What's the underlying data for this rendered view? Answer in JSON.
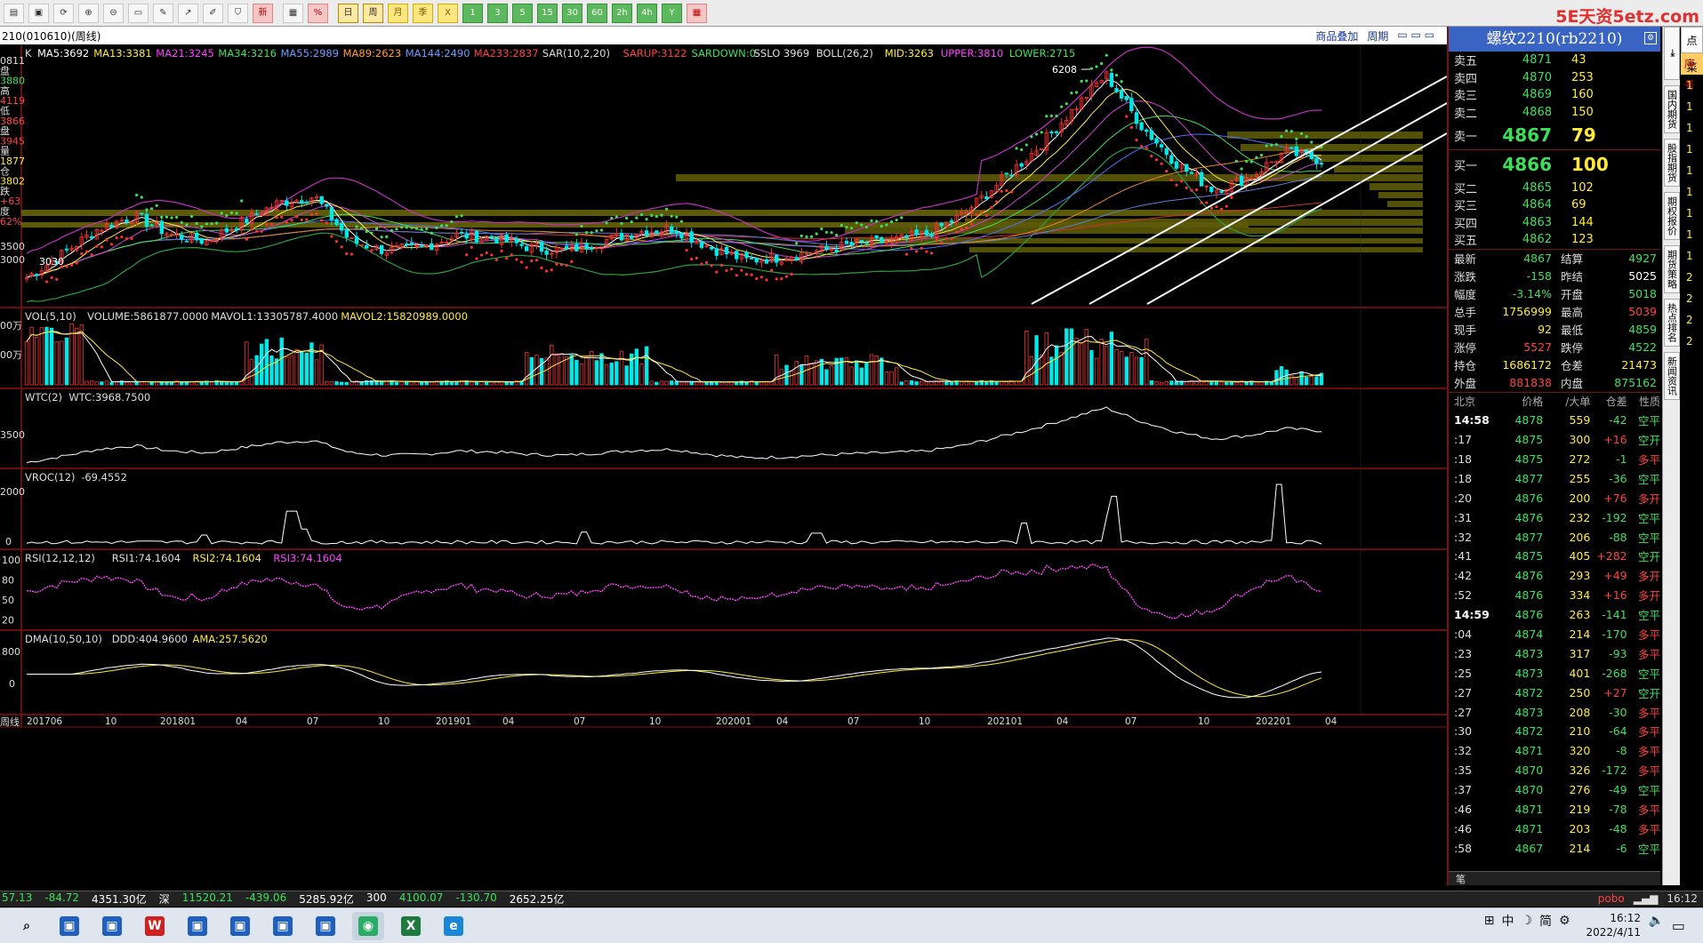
{
  "app": {
    "brand": "5E天资5etz.com",
    "symbol_line": "210(010610)(周线)",
    "tabs_right": [
      "商品叠加",
      "周期"
    ]
  },
  "toolbar": {
    "buttons": [
      {
        "name": "file",
        "label": "▤"
      },
      {
        "name": "open",
        "label": "▣"
      },
      {
        "name": "refresh",
        "label": "⟳"
      },
      {
        "name": "zoom-in",
        "label": "⊕"
      },
      {
        "name": "zoom-out",
        "label": "⊖"
      },
      {
        "name": "window",
        "label": "▭"
      },
      {
        "name": "draw",
        "label": "✎"
      },
      {
        "name": "line",
        "label": "↗"
      },
      {
        "name": "pen",
        "label": "✐"
      },
      {
        "name": "funnel",
        "label": "⛉"
      },
      {
        "name": "new",
        "label": "新"
      },
      {
        "name": "table",
        "label": "▦"
      },
      {
        "name": "percent",
        "label": "%"
      },
      {
        "name": "day",
        "label": "日"
      },
      {
        "name": "week",
        "label": "周"
      },
      {
        "name": "month",
        "label": "月"
      },
      {
        "name": "season",
        "label": "季"
      },
      {
        "name": "x",
        "label": "X"
      },
      {
        "name": "m1",
        "label": "1"
      },
      {
        "name": "m3",
        "label": "3"
      },
      {
        "name": "m5",
        "label": "5"
      },
      {
        "name": "m15",
        "label": "15"
      },
      {
        "name": "m30",
        "label": "30"
      },
      {
        "name": "m60",
        "label": "60"
      },
      {
        "name": "h2",
        "label": "2h"
      },
      {
        "name": "h4",
        "label": "4h"
      },
      {
        "name": "y",
        "label": "Y"
      },
      {
        "name": "calendar",
        "label": "▦"
      }
    ]
  },
  "main_legend": {
    "k": "K",
    "items": [
      {
        "t": "MA5:3692",
        "c": "#ffffff"
      },
      {
        "t": "MA13:3381",
        "c": "#ffea3a"
      },
      {
        "t": "MA21:3245",
        "c": "#ff40ff"
      },
      {
        "t": "MA34:3216",
        "c": "#3de05b"
      },
      {
        "t": "MA55:2989",
        "c": "#6a9cff"
      },
      {
        "t": "MA89:2623",
        "c": "#ff9a30"
      },
      {
        "t": "MA144:2490",
        "c": "#6a9cff"
      },
      {
        "t": "MA233:2837",
        "c": "#ff4040"
      },
      {
        "t": "SAR(10,2,20)",
        "c": "#dddddd"
      },
      {
        "t": "SARUP:3122",
        "c": "#ff4040"
      },
      {
        "t": "SARDOWN:0",
        "c": "#3de05b"
      },
      {
        "t": "SSLO 3969",
        "c": "#dddddd"
      },
      {
        "t": "BOLL(26,2)",
        "c": "#dddddd"
      },
      {
        "t": "MID:3263",
        "c": "#ffea3a"
      },
      {
        "t": "UPPER:3810",
        "c": "#ff40ff"
      },
      {
        "t": "LOWER:2715",
        "c": "#3de05b"
      }
    ]
  },
  "left_axis": {
    "main": [
      "0811",
      "盘",
      "3880",
      "高",
      "4119",
      "低",
      "3866",
      "盘",
      "3945",
      "量",
      "1877",
      "仓",
      "3802",
      "跌",
      "+63",
      "度",
      "62%"
    ],
    "main_ticks": [
      "3500",
      "3000"
    ],
    "vol_ticks": [
      "00万",
      "00万"
    ],
    "wtc_ticks": [
      "3500"
    ],
    "vroc_ticks": [
      "2000",
      "0"
    ],
    "rsi_ticks": [
      "100",
      "80",
      "50",
      "20"
    ],
    "dma_ticks": [
      "800",
      "0"
    ]
  },
  "annotations": {
    "high": "6208",
    "low": "3030"
  },
  "sub_legends": {
    "vol": [
      {
        "t": "VOL(5,10)",
        "c": "#dddddd"
      },
      {
        "t": "VOLUME:5861877.0000",
        "c": "#dddddd"
      },
      {
        "t": "MAVOL1:13305787.4000",
        "c": "#dddddd"
      },
      {
        "t": "MAVOL2:15820989.0000",
        "c": "#ffea3a"
      }
    ],
    "wtc": [
      {
        "t": "WTC(2)",
        "c": "#dddddd"
      },
      {
        "t": "WTC:3968.7500",
        "c": "#dddddd"
      }
    ],
    "vroc": [
      {
        "t": "VROC(12)",
        "c": "#dddddd"
      },
      {
        "t": "-69.4552",
        "c": "#dddddd"
      }
    ],
    "rsi": [
      {
        "t": "RSI(12,12,12)",
        "c": "#dddddd"
      },
      {
        "t": "RSI1:74.1604",
        "c": "#dddddd"
      },
      {
        "t": "RSI2:74.1604",
        "c": "#ffea3a"
      },
      {
        "t": "RSI3:74.1604",
        "c": "#ff40ff"
      }
    ],
    "dma": [
      {
        "t": "DMA(10,50,10)",
        "c": "#dddddd"
      },
      {
        "t": "DDD:404.9600",
        "c": "#dddddd"
      },
      {
        "t": "AMA:257.5620",
        "c": "#ffea3a"
      }
    ]
  },
  "x_axis": {
    "period_label": "周线",
    "labels": [
      "201706",
      "10",
      "201801",
      "04",
      "07",
      "10",
      "201901",
      "04",
      "07",
      "10",
      "202001",
      "04",
      "07",
      "10",
      "202101",
      "04",
      "07",
      "10",
      "202201",
      "04"
    ]
  },
  "quote": {
    "title": "螺纹2210(rb2210)",
    "asks": [
      {
        "k": "卖五",
        "p": "4871",
        "v": "43"
      },
      {
        "k": "卖四",
        "p": "4870",
        "v": "253"
      },
      {
        "k": "卖三",
        "p": "4869",
        "v": "160"
      },
      {
        "k": "卖二",
        "p": "4868",
        "v": "150"
      },
      {
        "k": "卖一",
        "p": "4867",
        "v": "79"
      }
    ],
    "bids": [
      {
        "k": "买一",
        "p": "4866",
        "v": "100"
      },
      {
        "k": "买二",
        "p": "4865",
        "v": "102"
      },
      {
        "k": "买三",
        "p": "4864",
        "v": "69"
      },
      {
        "k": "买四",
        "p": "4863",
        "v": "144"
      },
      {
        "k": "买五",
        "p": "4862",
        "v": "123"
      }
    ],
    "stats": [
      {
        "k1": "最新",
        "v1": "4867",
        "c1": "g",
        "k2": "结算",
        "v2": "4927",
        "c2": "g"
      },
      {
        "k1": "涨跌",
        "v1": "-158",
        "c1": "g",
        "k2": "昨结",
        "v2": "5025",
        "c2": "w"
      },
      {
        "k1": "幅度",
        "v1": "-3.14%",
        "c1": "g",
        "k2": "开盘",
        "v2": "5018",
        "c2": "g"
      },
      {
        "k1": "总手",
        "v1": "1756999",
        "c1": "y",
        "k2": "最高",
        "v2": "5039",
        "c2": "r"
      },
      {
        "k1": "现手",
        "v1": "92",
        "c1": "y",
        "k2": "最低",
        "v2": "4859",
        "c2": "g"
      },
      {
        "k1": "涨停",
        "v1": "5527",
        "c1": "r",
        "k2": "跌停",
        "v2": "4522",
        "c2": "g"
      },
      {
        "k1": "持仓",
        "v1": "1686172",
        "c1": "y",
        "k2": "仓差",
        "v2": "21473",
        "c2": "y"
      },
      {
        "k1": "外盘",
        "v1": "881838",
        "c1": "r",
        "k2": "内盘",
        "v2": "875162",
        "c2": "g"
      }
    ],
    "tick_header": [
      "北京",
      "价格",
      "∕大单",
      "仓差",
      "性质"
    ],
    "ticks": [
      {
        "t": "14:58",
        "b": true,
        "p": "4878",
        "v": "559",
        "d": "-42",
        "dc": "g",
        "n": "空平",
        "nc": "g",
        "vc": "r"
      },
      {
        "t": ":17",
        "p": "4875",
        "v": "300",
        "d": "+16",
        "dc": "r",
        "n": "空开",
        "nc": "g",
        "vc": "y"
      },
      {
        "t": ":18",
        "p": "4875",
        "v": "272",
        "d": "-1",
        "dc": "g",
        "n": "多平",
        "nc": "r",
        "vc": "y"
      },
      {
        "t": ":18",
        "p": "4877",
        "v": "255",
        "d": "-36",
        "dc": "g",
        "n": "空平",
        "nc": "g",
        "vc": "r"
      },
      {
        "t": ":20",
        "p": "4876",
        "v": "200",
        "d": "+76",
        "dc": "r",
        "n": "多开",
        "nc": "r",
        "vc": "r"
      },
      {
        "t": ":31",
        "p": "4876",
        "v": "232",
        "d": "-192",
        "dc": "g",
        "n": "空平",
        "nc": "g",
        "vc": "r"
      },
      {
        "t": ":32",
        "p": "4877",
        "v": "206",
        "d": "-88",
        "dc": "g",
        "n": "空平",
        "nc": "g",
        "vc": "r"
      },
      {
        "t": ":41",
        "p": "4875",
        "v": "405",
        "d": "+282",
        "dc": "r",
        "n": "空开",
        "nc": "g",
        "vc": "y"
      },
      {
        "t": ":42",
        "p": "4876",
        "v": "293",
        "d": "+49",
        "dc": "r",
        "n": "多开",
        "nc": "r",
        "vc": "r"
      },
      {
        "t": ":52",
        "p": "4876",
        "v": "334",
        "d": "+16",
        "dc": "r",
        "n": "多开",
        "nc": "r",
        "vc": "r"
      },
      {
        "t": "14:59",
        "b": true,
        "p": "4876",
        "v": "263",
        "d": "-141",
        "dc": "g",
        "n": "空平",
        "nc": "g",
        "vc": "r"
      },
      {
        "t": ":04",
        "p": "4874",
        "v": "214",
        "d": "-170",
        "dc": "g",
        "n": "多平",
        "nc": "r",
        "vc": "y"
      },
      {
        "t": ":23",
        "p": "4873",
        "v": "317",
        "d": "-93",
        "dc": "g",
        "n": "多平",
        "nc": "r",
        "vc": "y"
      },
      {
        "t": ":25",
        "p": "4873",
        "v": "401",
        "d": "-268",
        "dc": "g",
        "n": "空平",
        "nc": "g",
        "vc": "r"
      },
      {
        "t": ":27",
        "p": "4872",
        "v": "250",
        "d": "+27",
        "dc": "r",
        "n": "空开",
        "nc": "g",
        "vc": "y"
      },
      {
        "t": ":27",
        "p": "4873",
        "v": "208",
        "d": "-30",
        "dc": "g",
        "n": "多平",
        "nc": "r",
        "vc": "y"
      },
      {
        "t": ":30",
        "p": "4872",
        "v": "210",
        "d": "-64",
        "dc": "g",
        "n": "多平",
        "nc": "r",
        "vc": "y"
      },
      {
        "t": ":32",
        "p": "4871",
        "v": "320",
        "d": "-8",
        "dc": "g",
        "n": "多平",
        "nc": "r",
        "vc": "y"
      },
      {
        "t": ":35",
        "p": "4870",
        "v": "326",
        "d": "-172",
        "dc": "g",
        "n": "多平",
        "nc": "r",
        "vc": "y"
      },
      {
        "t": ":37",
        "p": "4870",
        "v": "276",
        "d": "-49",
        "dc": "g",
        "n": "空平",
        "nc": "g",
        "vc": "r"
      },
      {
        "t": ":46",
        "p": "4871",
        "v": "219",
        "d": "-78",
        "dc": "g",
        "n": "多平",
        "nc": "r",
        "vc": "y"
      },
      {
        "t": ":46",
        "p": "4871",
        "v": "203",
        "d": "-48",
        "dc": "g",
        "n": "多平",
        "nc": "r",
        "vc": "y"
      },
      {
        "t": ":58",
        "p": "4867",
        "v": "214",
        "d": "-6",
        "dc": "g",
        "n": "空平",
        "nc": "g",
        "vc": "r"
      }
    ],
    "bottom_tab": "笔"
  },
  "side_tabs": [
    "国内期货",
    "股指期货",
    "期权报价",
    "期货策略",
    "热点排名",
    "新闻资讯"
  ],
  "far_right": {
    "hdr": "点菜",
    "hdr2": "序号",
    "cells": [
      "1",
      "1",
      "1",
      "1",
      "1",
      "1",
      "1",
      "1",
      "1",
      "2",
      "2",
      "2",
      "2"
    ]
  },
  "status": {
    "segs": [
      {
        "t": "57.13",
        "c": "g"
      },
      {
        "t": "-84.72",
        "c": "g"
      },
      {
        "t": "4351.30亿",
        "c": "w"
      },
      {
        "t": "深",
        "c": "w"
      },
      {
        "t": "11520.21",
        "c": "g"
      },
      {
        "t": "-439.06",
        "c": "g"
      },
      {
        "t": "5285.92亿",
        "c": "w"
      },
      {
        "t": "300",
        "c": "w"
      },
      {
        "t": "4100.07",
        "c": "g"
      },
      {
        "t": "-130.70",
        "c": "g"
      },
      {
        "t": "2652.25亿",
        "c": "w"
      }
    ],
    "right": [
      "pobo",
      "16:12"
    ]
  },
  "taskbar": {
    "apps": [
      "search",
      "app1",
      "app2",
      "wps",
      "app3",
      "app4",
      "app5",
      "app6",
      "wechat",
      "excel",
      "edge"
    ],
    "tray": [
      "中",
      "简"
    ],
    "time": "16:12",
    "date": "2022/4/11"
  },
  "chart_data": {
    "type": "candlestick",
    "title": "",
    "period": "weekly",
    "x_labels": [
      "201706",
      "10",
      "201801",
      "04",
      "07",
      "10",
      "201901",
      "04",
      "07",
      "10",
      "202001",
      "04",
      "07",
      "10",
      "202101",
      "04",
      "07",
      "10",
      "202201",
      "04"
    ],
    "close_approx": [
      3030,
      3400,
      3800,
      4000,
      3700,
      3600,
      3900,
      4200,
      4300,
      3600,
      3450,
      3500,
      3700,
      3650,
      3500,
      3450,
      3600,
      3750,
      3800,
      3500,
      3300,
      3350,
      3450,
      3550,
      3600,
      3700,
      4000,
      4500,
      5000,
      5600,
      6208,
      5400,
      4800,
      4400,
      4600,
      5000,
      4867
    ],
    "annotations": {
      "high": 6208,
      "low": 3030
    },
    "subcharts": [
      "VOL",
      "WTC",
      "VROC",
      "RSI",
      "DMA"
    ]
  }
}
